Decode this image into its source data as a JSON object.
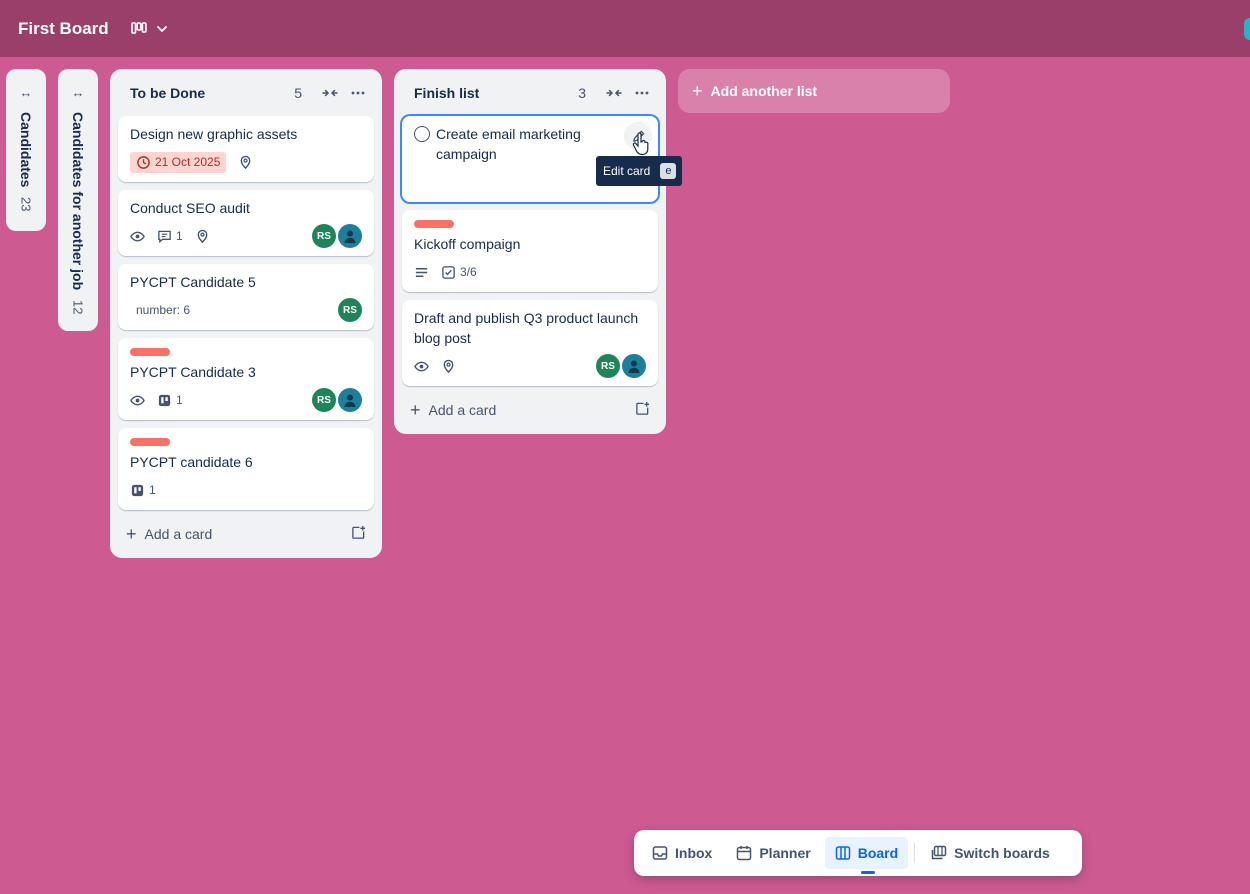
{
  "header": {
    "board_title": "First Board"
  },
  "collapsed_lists": [
    {
      "title": "Candidates",
      "count": "23"
    },
    {
      "title": "Candidates for another job",
      "count": "12"
    }
  ],
  "lists": [
    {
      "title": "To be Done",
      "count": "5",
      "add_card_label": "Add a card",
      "cards": [
        {
          "title": "Design new graphic assets",
          "date": "21 Oct 2025"
        },
        {
          "title": "Conduct SEO audit",
          "comments": "1",
          "members": [
            "RS"
          ]
        },
        {
          "title": "PYCPT Candidate 5",
          "field": "number: 6",
          "members": [
            "RS"
          ]
        },
        {
          "title": "PYCPT Candidate 3",
          "attachments": "1",
          "members": [
            "RS"
          ]
        },
        {
          "title": "PYCPT candidate 6",
          "attachments": "1"
        }
      ]
    },
    {
      "title": "Finish list",
      "count": "3",
      "add_card_label": "Add a card",
      "cards": [
        {
          "title": "Create email marketing campaign"
        },
        {
          "title": "Kickoff compaign",
          "checklist": "3/6"
        },
        {
          "title": "Draft and publish Q3 product launch blog post",
          "members": [
            "RS"
          ]
        }
      ]
    }
  ],
  "tooltip": {
    "label": "Edit card",
    "shortcut": "e"
  },
  "add_list_label": "Add another list",
  "switcher": {
    "inbox": "Inbox",
    "planner": "Planner",
    "board": "Board",
    "switch_boards": "Switch boards"
  },
  "colors": {
    "background": "#cd5a90",
    "header": "#9a3f69",
    "label_red": "#f87168",
    "member_green": "#1f845a",
    "accent": "#0c66e4"
  }
}
